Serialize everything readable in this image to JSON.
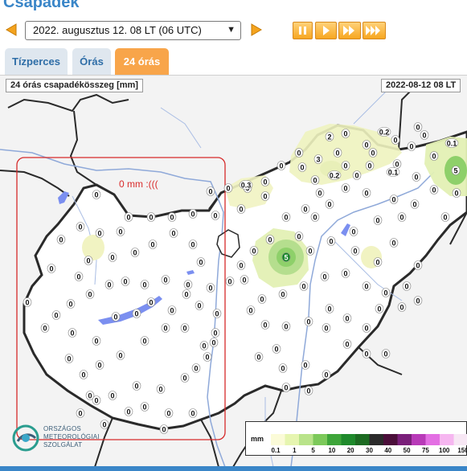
{
  "page": {
    "title": "Csapadék"
  },
  "controls": {
    "prev_icon": "arrow-left-icon",
    "next_icon": "arrow-right-icon",
    "date_select": {
      "selected": "2022. augusztus 12. 08 LT (06  UTC)"
    },
    "playback_icons": [
      "pause-icon",
      "play-icon",
      "fast-forward-icon",
      "fastest-forward-icon"
    ]
  },
  "tabs": [
    {
      "label": "Tízperces",
      "active": false
    },
    {
      "label": "Órás",
      "active": false
    },
    {
      "label": "24 órás",
      "active": true
    }
  ],
  "map": {
    "title": "24 órás csapadékösszeg [mm]",
    "timestamp": "2022-08-12 08 LT",
    "region_note": "0 mm :(((",
    "station_values": [
      "0",
      "0.1",
      "0.2",
      "0.3",
      "2",
      "3",
      "5"
    ],
    "highlighted_values": [
      {
        "value": "5"
      },
      {
        "value": "5"
      },
      {
        "value": "0.3"
      },
      {
        "value": "3"
      },
      {
        "value": "2"
      },
      {
        "value": "0.2"
      },
      {
        "value": "0.2"
      },
      {
        "value": "0.1"
      },
      {
        "value": "0.1"
      }
    ]
  },
  "logo": {
    "lines": [
      "ORSZÁGOS",
      "METEOROLÓGIAI",
      "SZOLGÁLAT"
    ]
  },
  "legend": {
    "unit": "mm",
    "ticks": [
      "0.1",
      "1",
      "5",
      "10",
      "20",
      "30",
      "40",
      "50",
      "75",
      "100",
      "150"
    ],
    "colors": [
      "#fbfbd8",
      "#e6f5b0",
      "#b9e38a",
      "#7cc95a",
      "#3ea53a",
      "#1f8a2c",
      "#1d6b22",
      "#2b2b2b",
      "#4b0f3a",
      "#7a1f7a",
      "#b83ab8",
      "#e36fe3",
      "#f6b6f0",
      "#f7e7f4"
    ]
  },
  "accent": {
    "orange": "#f8a54a",
    "blue": "#3a86c8",
    "note_red": "#d92b2b"
  }
}
